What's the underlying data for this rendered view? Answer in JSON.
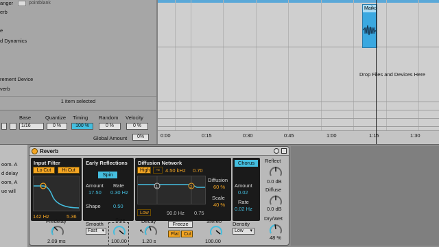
{
  "browser": {
    "items": [
      {
        "text": "anger"
      },
      {
        "text": "e"
      },
      {
        "text": "d Dynamics"
      },
      {
        "text": "erb"
      },
      {
        "text": "rement Device"
      },
      {
        "text": "verb"
      }
    ],
    "top_tag": "pointblank",
    "selection_status": "1 item selected"
  },
  "groove": {
    "headers": [
      "Base",
      "Quantize",
      "Timing",
      "Random",
      "Velocity"
    ],
    "base_value": "1/16",
    "quantize": "0 %",
    "timing": "100 %",
    "random": "0 %",
    "velocity": "0 %",
    "global_amount_label": "Global Amount",
    "global_amount": "0%"
  },
  "arrangement": {
    "clip_name": "Maiko",
    "drop_text": "Drop Files and Devices Here",
    "timeline": [
      "0:00",
      "0:15",
      "0:30",
      "0:45",
      "1:00",
      "1:15",
      "1:30"
    ]
  },
  "info": {
    "lines": [
      "oom. A",
      "d delay",
      "oom, A",
      "ue will"
    ]
  },
  "reverb": {
    "title": "Reverb",
    "input_filter": {
      "title": "Input Filter",
      "lo_cut": "Lo Cut",
      "hi_cut": "Hi Cut",
      "low_freq": "142 Hz",
      "q": "5.36"
    },
    "early": {
      "title": "Early Reflections",
      "spin": "Spin",
      "amount_label": "Amount",
      "amount": "17.50",
      "rate_label": "Rate",
      "rate": "0.30 Hz",
      "shape_label": "Shape",
      "shape": "0.50"
    },
    "diffusion": {
      "title": "Diffusion Network",
      "high": "High",
      "high_freq": "4.50 kHz",
      "high_val": "0.70",
      "diffusion_label": "Diffusion",
      "diffusion": "60 %",
      "scale_label": "Scale",
      "scale": "40 %",
      "low": "Low",
      "low_freq": "90.0 Hz",
      "low_val": "0.75"
    },
    "chorus": {
      "btn": "Chorus",
      "amount_label": "Amount",
      "amount": "0.02",
      "rate_label": "Rate",
      "rate": "0.02 Hz"
    },
    "side": {
      "reflect_label": "Reflect",
      "reflect": "0.0 dB",
      "diffuse_label": "Diffuse",
      "diffuse": "0.0 dB",
      "drywet_label": "Dry/Wet",
      "drywet": "48 %"
    },
    "bottom": {
      "predelay_label": "Predelay",
      "predelay": "2.09 ms",
      "smooth_label": "Smooth",
      "smooth": "Fast",
      "size_label": "Size",
      "size": "100.00",
      "decay_label": "Decay",
      "decay": "1.20 s",
      "freeze": "Freeze",
      "flat": "Flat",
      "cut": "Cut",
      "stereo_label": "Stereo",
      "stereo": "100.00",
      "density_label": "Density",
      "density": "Low"
    }
  },
  "colors": {
    "accent_orange": "#f5a623",
    "accent_blue": "#44bedf"
  }
}
